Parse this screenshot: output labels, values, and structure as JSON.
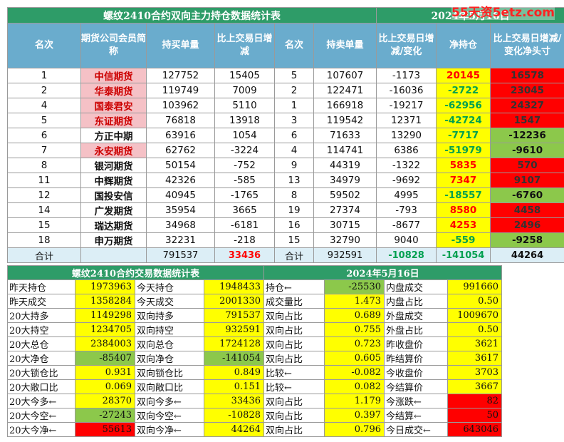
{
  "top": {
    "title": "螺纹2410合约双向主力持仓数据统计表",
    "date": "2024年5月16日",
    "headers": [
      "名次",
      "期货公司会员简称",
      "持买单量",
      "比上交易日增减",
      "名次",
      "持卖单量",
      "比上交易日增减/变化",
      "净持仓",
      "比上交易日增减/变化净头寸"
    ],
    "rows": [
      [
        "1",
        "中信期货",
        "127752",
        "15405",
        "5",
        "107607",
        "-1173",
        "20145",
        "16578"
      ],
      [
        "2",
        "华泰期货",
        "119749",
        "7009",
        "2",
        "122471",
        "-16036",
        "-2722",
        "23045"
      ],
      [
        "4",
        "国泰君安",
        "103962",
        "5110",
        "1",
        "166918",
        "-19217",
        "-62956",
        "24327"
      ],
      [
        "5",
        "东证期货",
        "76818",
        "13918",
        "3",
        "119542",
        "12371",
        "-42724",
        "1547"
      ],
      [
        "6",
        "方正中期",
        "63916",
        "1054",
        "6",
        "71633",
        "13290",
        "-7717",
        "-12236"
      ],
      [
        "7",
        "永安期货",
        "62762",
        "-3224",
        "4",
        "114741",
        "6386",
        "-51979",
        "-9610"
      ],
      [
        "8",
        "银河期货",
        "50154",
        "-752",
        "9",
        "44319",
        "-1322",
        "5835",
        "570"
      ],
      [
        "11",
        "中辉期货",
        "42326",
        "-585",
        "13",
        "34979",
        "-9692",
        "7347",
        "9107"
      ],
      [
        "12",
        "国投安信",
        "40945",
        "-1765",
        "8",
        "59502",
        "4995",
        "-18557",
        "-6760"
      ],
      [
        "14",
        "广发期货",
        "35954",
        "3665",
        "19",
        "27374",
        "-793",
        "8580",
        "4458"
      ],
      [
        "15",
        "瑞达期货",
        "34968",
        "-6181",
        "16",
        "30715",
        "-8677",
        "4253",
        "2496"
      ],
      [
        "18",
        "申万期货",
        "32231",
        "-218",
        "15",
        "32790",
        "9040",
        "-559",
        "-9258"
      ]
    ],
    "total": [
      "合计",
      "",
      "791537",
      "33436",
      "合计",
      "932591",
      "-10828",
      "-141054",
      "44264"
    ]
  },
  "bottom": {
    "title": "螺纹2410合约交易数据统计表",
    "date": "2024年5月16日",
    "rows": [
      [
        "昨天持仓",
        "1973963",
        "今天持仓",
        "1948433",
        "持仓←",
        "-25530",
        "内盘成交",
        "991660"
      ],
      [
        "昨天成交",
        "1358284",
        "今天成交",
        "2001330",
        "成交量比",
        "1.473",
        "内盘占比",
        "0.50"
      ],
      [
        "20大持多",
        "1149298",
        "双向持多",
        "791537",
        "双向占比",
        "0.689",
        "外盘成交",
        "1009670"
      ],
      [
        "20大持空",
        "1234705",
        "双向持空",
        "932591",
        "双向占比",
        "0.755",
        "外盘占比",
        "0.50"
      ],
      [
        "20大总仓",
        "2384003",
        "双向总仓",
        "1724128",
        "双向占比",
        "0.723",
        "昨收盘价",
        "3621"
      ],
      [
        "20大净仓",
        "-85407",
        "双向净仓",
        "-141054",
        "双向占比",
        "0.605",
        "昨结算价",
        "3617"
      ],
      [
        "20大锁仓比",
        "0.931",
        "双向锁仓比",
        "0.849",
        "比较←",
        "-0.082",
        "今收盘价",
        "3703"
      ],
      [
        "20大敞口比",
        "0.069",
        "双向敞口比",
        "0.151",
        "比较←",
        "0.082",
        "今结算价",
        "3667"
      ],
      [
        "20大今多←",
        "28370",
        "双向今多←",
        "33436",
        "双向占比",
        "1.179",
        "今涨跌←",
        "82"
      ],
      [
        "20大今空←",
        "-27243",
        "双向今空←",
        "-10828",
        "双向占比",
        "0.397",
        "今结算←",
        "50"
      ],
      [
        "20大今净←",
        "55613",
        "双向今净←",
        "44264",
        "双向占比",
        "0.796",
        "今日成交←",
        "643046"
      ]
    ]
  },
  "watermark": "55天资5etz.com",
  "colors": {
    "green_header": "#2e9c68",
    "blue_header": "#6aaccd",
    "yellow": "#ffff00",
    "light_green": "#8cc84b",
    "red": "#ff0000",
    "pink": "#f5c1c6"
  }
}
